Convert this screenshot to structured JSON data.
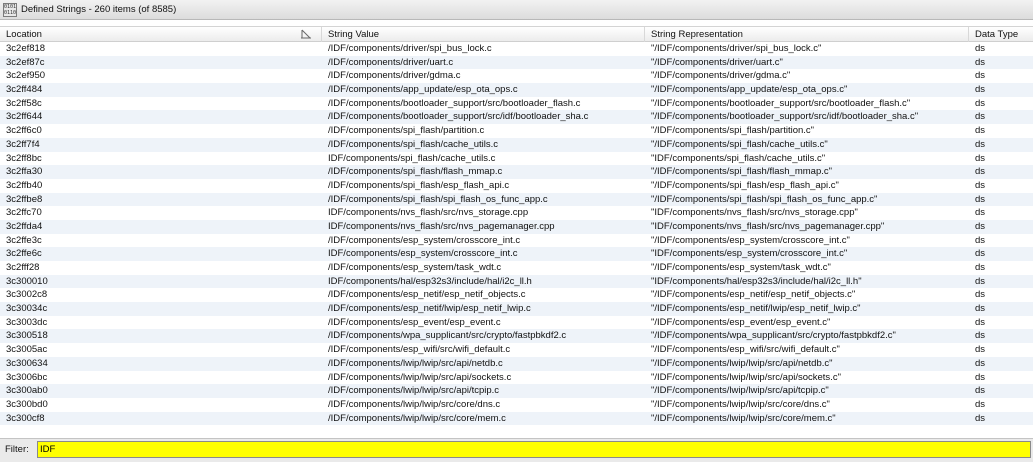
{
  "window": {
    "title": "Defined Strings - 260 items (of 8585)",
    "icon_text": "0101 0110"
  },
  "table": {
    "columns": [
      "Location",
      "String Value",
      "String Representation",
      "Data Type"
    ],
    "rows": [
      [
        "3c2ef818",
        "/IDF/components/driver/spi_bus_lock.c",
        "\"/IDF/components/driver/spi_bus_lock.c\"",
        "ds"
      ],
      [
        "3c2ef87c",
        "/IDF/components/driver/uart.c",
        "\"/IDF/components/driver/uart.c\"",
        "ds"
      ],
      [
        "3c2ef950",
        "/IDF/components/driver/gdma.c",
        "\"/IDF/components/driver/gdma.c\"",
        "ds"
      ],
      [
        "3c2ff484",
        "/IDF/components/app_update/esp_ota_ops.c",
        "\"/IDF/components/app_update/esp_ota_ops.c\"",
        "ds"
      ],
      [
        "3c2ff58c",
        "/IDF/components/bootloader_support/src/bootloader_flash.c",
        "\"/IDF/components/bootloader_support/src/bootloader_flash.c\"",
        "ds"
      ],
      [
        "3c2ff644",
        "/IDF/components/bootloader_support/src/idf/bootloader_sha.c",
        "\"/IDF/components/bootloader_support/src/idf/bootloader_sha.c\"",
        "ds"
      ],
      [
        "3c2ff6c0",
        "/IDF/components/spi_flash/partition.c",
        "\"/IDF/components/spi_flash/partition.c\"",
        "ds"
      ],
      [
        "3c2ff7f4",
        "/IDF/components/spi_flash/cache_utils.c",
        "\"/IDF/components/spi_flash/cache_utils.c\"",
        "ds"
      ],
      [
        "3c2ff8bc",
        "IDF/components/spi_flash/cache_utils.c",
        "\"IDF/components/spi_flash/cache_utils.c\"",
        "ds"
      ],
      [
        "3c2ffa30",
        "/IDF/components/spi_flash/flash_mmap.c",
        "\"/IDF/components/spi_flash/flash_mmap.c\"",
        "ds"
      ],
      [
        "3c2ffb40",
        "/IDF/components/spi_flash/esp_flash_api.c",
        "\"/IDF/components/spi_flash/esp_flash_api.c\"",
        "ds"
      ],
      [
        "3c2ffbe8",
        "/IDF/components/spi_flash/spi_flash_os_func_app.c",
        "\"/IDF/components/spi_flash/spi_flash_os_func_app.c\"",
        "ds"
      ],
      [
        "3c2ffc70",
        "IDF/components/nvs_flash/src/nvs_storage.cpp",
        "\"IDF/components/nvs_flash/src/nvs_storage.cpp\"",
        "ds"
      ],
      [
        "3c2ffda4",
        "IDF/components/nvs_flash/src/nvs_pagemanager.cpp",
        "\"IDF/components/nvs_flash/src/nvs_pagemanager.cpp\"",
        "ds"
      ],
      [
        "3c2ffe3c",
        "/IDF/components/esp_system/crosscore_int.c",
        "\"/IDF/components/esp_system/crosscore_int.c\"",
        "ds"
      ],
      [
        "3c2ffe6c",
        "IDF/components/esp_system/crosscore_int.c",
        "\"IDF/components/esp_system/crosscore_int.c\"",
        "ds"
      ],
      [
        "3c2fff28",
        "/IDF/components/esp_system/task_wdt.c",
        "\"/IDF/components/esp_system/task_wdt.c\"",
        "ds"
      ],
      [
        "3c300010",
        "IDF/components/hal/esp32s3/include/hal/i2c_ll.h",
        "\"IDF/components/hal/esp32s3/include/hal/i2c_ll.h\"",
        "ds"
      ],
      [
        "3c3002c8",
        "/IDF/components/esp_netif/esp_netif_objects.c",
        "\"/IDF/components/esp_netif/esp_netif_objects.c\"",
        "ds"
      ],
      [
        "3c30034c",
        "/IDF/components/esp_netif/lwip/esp_netif_lwip.c",
        "\"/IDF/components/esp_netif/lwip/esp_netif_lwip.c\"",
        "ds"
      ],
      [
        "3c3003dc",
        "/IDF/components/esp_event/esp_event.c",
        "\"/IDF/components/esp_event/esp_event.c\"",
        "ds"
      ],
      [
        "3c300518",
        "/IDF/components/wpa_supplicant/src/crypto/fastpbkdf2.c",
        "\"/IDF/components/wpa_supplicant/src/crypto/fastpbkdf2.c\"",
        "ds"
      ],
      [
        "3c3005ac",
        "/IDF/components/esp_wifi/src/wifi_default.c",
        "\"/IDF/components/esp_wifi/src/wifi_default.c\"",
        "ds"
      ],
      [
        "3c300634",
        "/IDF/components/lwip/lwip/src/api/netdb.c",
        "\"/IDF/components/lwip/lwip/src/api/netdb.c\"",
        "ds"
      ],
      [
        "3c3006bc",
        "/IDF/components/lwip/lwip/src/api/sockets.c",
        "\"/IDF/components/lwip/lwip/src/api/sockets.c\"",
        "ds"
      ],
      [
        "3c300ab0",
        "/IDF/components/lwip/lwip/src/api/tcpip.c",
        "\"/IDF/components/lwip/lwip/src/api/tcpip.c\"",
        "ds"
      ],
      [
        "3c300bd0",
        "/IDF/components/lwip/lwip/src/core/dns.c",
        "\"/IDF/components/lwip/lwip/src/core/dns.c\"",
        "ds"
      ],
      [
        "3c300cf8",
        "/IDF/components/lwip/lwip/src/core/mem.c",
        "\"/IDF/components/lwip/lwip/src/core/mem.c\"",
        "ds"
      ]
    ]
  },
  "filter": {
    "label": "Filter:",
    "value": "IDF"
  },
  "colors": {
    "filter_background": "#ffff00",
    "alt_row": "#eef3f9"
  }
}
